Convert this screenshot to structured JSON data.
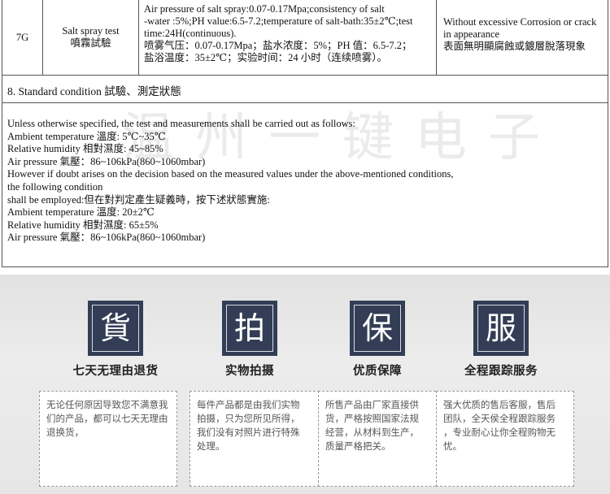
{
  "spec_row": {
    "number": "7G",
    "item_en": "Salt spray test",
    "item_zh": "噴霧試驗",
    "condition_lines": [
      "Air pressure of salt spray:0.07-0.17Mpa;consistency of salt",
      "-water :5%;PH value:6.5-7.2;temperature of salt-bath:35±2℃;test",
      " time:24H(continuous).",
      "喷雾气压：0.07-0.17Mpa；盐水浓度：5%；PH 值：6.5-7.2；",
      "盐浴温度：35±2℃；实验时间：24 小时（连续喷雾）。"
    ],
    "requirement_lines": [
      "Without excessive Corrosion or crack",
      "in appearance",
      "表面無明顯腐蝕或鍍層脫落現象"
    ]
  },
  "section8": {
    "heading": "8. Standard condition  試驗、測定狀態",
    "lines": [
      "Unless otherwise specified, the test and measurements shall be carried out as follows:",
      "Ambient temperature  溫度: 5℃~35℃",
      "Relative humidity  相對濕度: 45~85%",
      "Air pressure  氣壓：86~106kPa(860~1060mbar)",
      "However if doubt arises on the decision based on the measured values under the above-mentioned conditions,",
      "the following condition",
      "shall be employed:但在對判定產生疑義時，按下述狀態實施:",
      "Ambient temperature  溫度: 20±2℃",
      "Relative humidity  相對濕度: 65±5%",
      "Air pressure  氣壓：86~106kPa(860~1060mbar)"
    ]
  },
  "watermark": "温州一键电子",
  "promises": [
    {
      "char": "貨",
      "title": "七天无理由退货",
      "lines": [
        "无论任何原因导致您不满意我",
        "们的产品，都可以七天无理由",
        "退换货，"
      ]
    },
    {
      "char": "拍",
      "title": "实物拍摄",
      "lines": [
        "每件产品都是由我们实物",
        "拍摄，只为您所见所得，",
        "我们没有对照片进行特殊",
        "处理。"
      ]
    },
    {
      "char": "保",
      "title": "优质保障",
      "lines": [
        "所售产品由厂家直接供",
        "货，严格按照国家法规",
        "经营，从材料到生产，",
        "质量严格把关。"
      ]
    },
    {
      "char": "服",
      "title": "全程跟踪服务",
      "lines": [
        "强大优质的售后客服，售后",
        "团队，全天侯全程跟踪服务",
        "，专业耐心让你全程购物无",
        "忧。"
      ]
    }
  ],
  "colors": {
    "badge_bg": "#333d55",
    "panel_bg": "#e6e6e6",
    "border": "#555555"
  }
}
